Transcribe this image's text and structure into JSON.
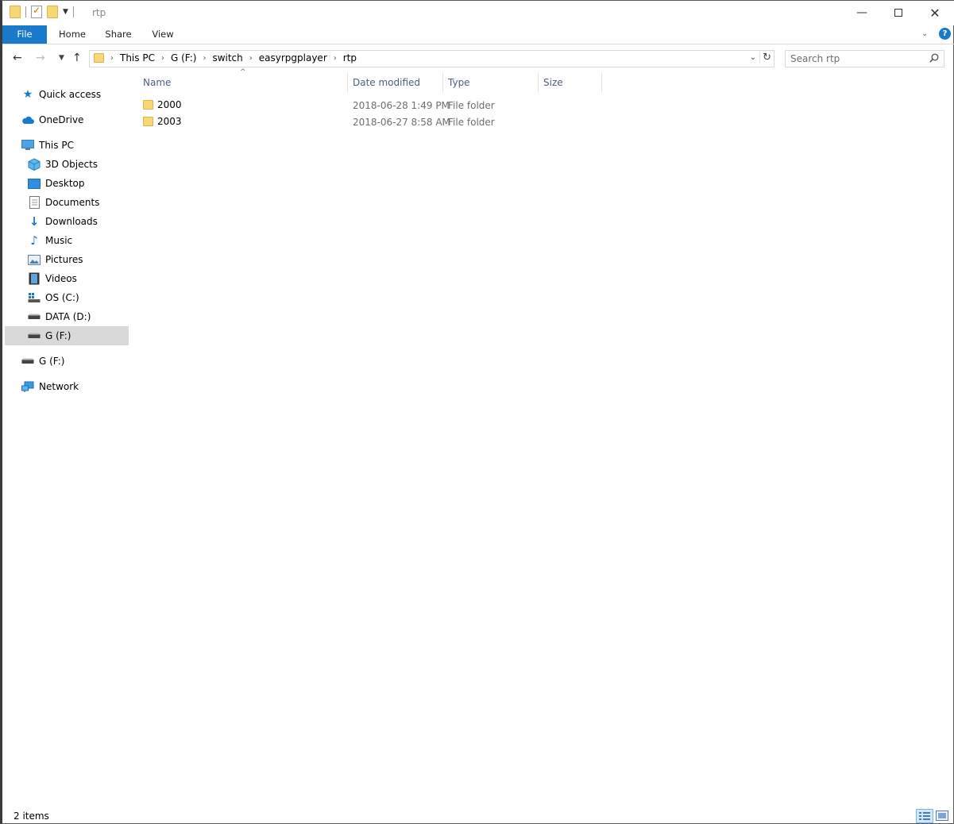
{
  "window": {
    "title": "rtp",
    "min_icon": "minimize-icon",
    "max_icon": "maximize-icon",
    "close_icon": "close-icon"
  },
  "ribbon": {
    "tabs": [
      {
        "label": "File"
      },
      {
        "label": "Home"
      },
      {
        "label": "Share"
      },
      {
        "label": "View"
      }
    ],
    "help_label": "?"
  },
  "address": {
    "crumbs": [
      "This PC",
      "G (F:)",
      "switch",
      "easyrpgplayer",
      "rtp"
    ]
  },
  "search": {
    "placeholder": "Search rtp"
  },
  "nav": {
    "items": [
      {
        "label": "Quick access",
        "icon": "star-icon"
      },
      {
        "label": "OneDrive",
        "icon": "cloud-icon"
      },
      {
        "label": "This PC",
        "icon": "computer-icon"
      },
      {
        "label": "3D Objects",
        "icon": "cube-icon"
      },
      {
        "label": "Desktop",
        "icon": "desktop-icon"
      },
      {
        "label": "Documents",
        "icon": "document-icon"
      },
      {
        "label": "Downloads",
        "icon": "download-arrow-icon"
      },
      {
        "label": "Music",
        "icon": "music-note-icon"
      },
      {
        "label": "Pictures",
        "icon": "pictures-icon"
      },
      {
        "label": "Videos",
        "icon": "film-icon"
      },
      {
        "label": "OS (C:)",
        "icon": "windows-drive-icon"
      },
      {
        "label": "DATA (D:)",
        "icon": "drive-icon"
      },
      {
        "label": "G (F:)",
        "icon": "drive-icon",
        "selected": true
      },
      {
        "label": "G (F:)",
        "icon": "drive-icon"
      },
      {
        "label": "Network",
        "icon": "network-icon"
      }
    ]
  },
  "columns": {
    "name": "Name",
    "date": "Date modified",
    "type": "Type",
    "size": "Size"
  },
  "files": [
    {
      "name": "2000",
      "date": "2018-06-28 1:49 PM",
      "type": "File folder",
      "size": ""
    },
    {
      "name": "2003",
      "date": "2018-06-27 8:58 AM",
      "type": "File folder",
      "size": ""
    }
  ],
  "status": {
    "item_count": "2 items"
  },
  "colors": {
    "accent": "#1979ca",
    "folder": "#f8d775",
    "selected_bg": "#d9d9d9",
    "header_text": "#4c607a",
    "secondary_text": "#6d6d6d"
  }
}
